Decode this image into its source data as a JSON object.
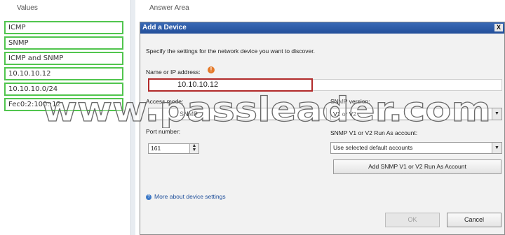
{
  "left": {
    "header": "Values",
    "items": [
      "ICMP",
      "SNMP",
      "ICMP and SNMP",
      "10.10.10.12",
      "10.10.10.0/24",
      "Fec0:2:100::12"
    ]
  },
  "right": {
    "header": "Answer Area"
  },
  "dialog": {
    "title": "Add a Device",
    "close_label": "X",
    "description": "Specify the settings for the network device you want to discover.",
    "name_label": "Name or IP address:",
    "warning_icon_glyph": "!",
    "name_value": "10.10.10.12",
    "access_mode_label": "Access mode:",
    "access_mode_value": "SNMP",
    "snmp_version_label": "SNMP version:",
    "snmp_version_value": "V1 or V2",
    "port_label": "Port number:",
    "port_value": "161",
    "runas_label": "SNMP V1 or V2 Run As account:",
    "runas_value": "Use selected default accounts",
    "add_runas_button": "Add SNMP V1 or V2 Run As Account",
    "help_link": "More about device settings",
    "ok_label": "OK",
    "cancel_label": "Cancel"
  },
  "watermark": "www.passleader.com",
  "colors": {
    "value_border": "#51c54e",
    "titlebar": "#2b5ba8",
    "name_border": "#b12a2a",
    "warning": "#e57a2a",
    "link": "#1f4f9b"
  }
}
